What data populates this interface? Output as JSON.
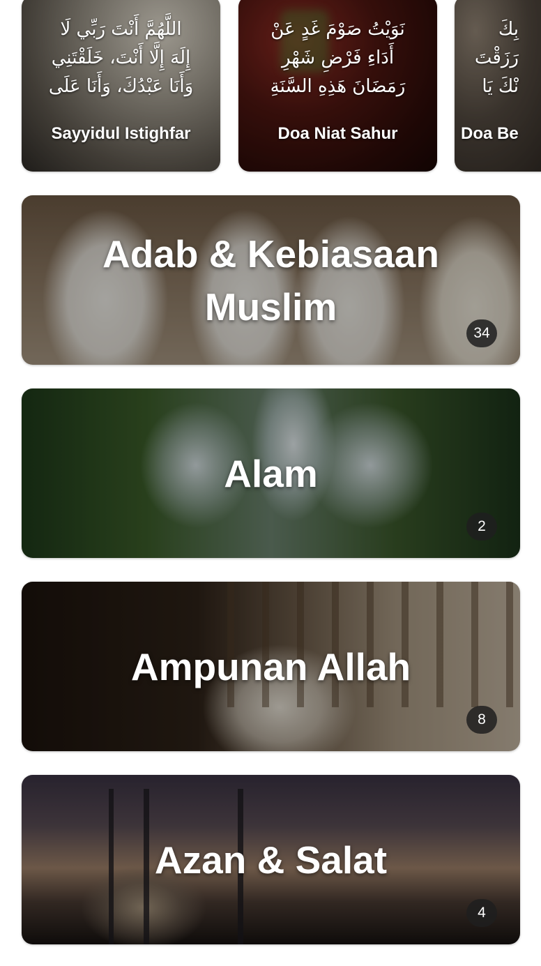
{
  "featured": [
    {
      "arabic": "اللَّهُمَّ أَنْتَ رَبِّي لَا\nإِلَهَ إِلَّا أَنْتَ، خَلَقْتَنِي\nوَأَنَا عَبْدُكَ، وَأَنَا عَلَى",
      "title": "Sayyidul Istighfar"
    },
    {
      "arabic": "نَوَيْتُ صَوْمَ غَدٍ عَنْ\nأَدَاءِ فَرْضِ شَهْرِ\nرَمَضَانَ هَذِهِ السَّنَةِ",
      "title": "Doa Niat Sahur"
    },
    {
      "arabic": "بِكَ\nرَزَقْتَ\nنْكَ يَا",
      "title": "Doa Be"
    }
  ],
  "categories": [
    {
      "title": "Adab & Kebiasaan Muslim",
      "count": "34"
    },
    {
      "title": "Alam",
      "count": "2"
    },
    {
      "title": "Ampunan Allah",
      "count": "8"
    },
    {
      "title": "Azan & Salat",
      "count": "4"
    }
  ]
}
